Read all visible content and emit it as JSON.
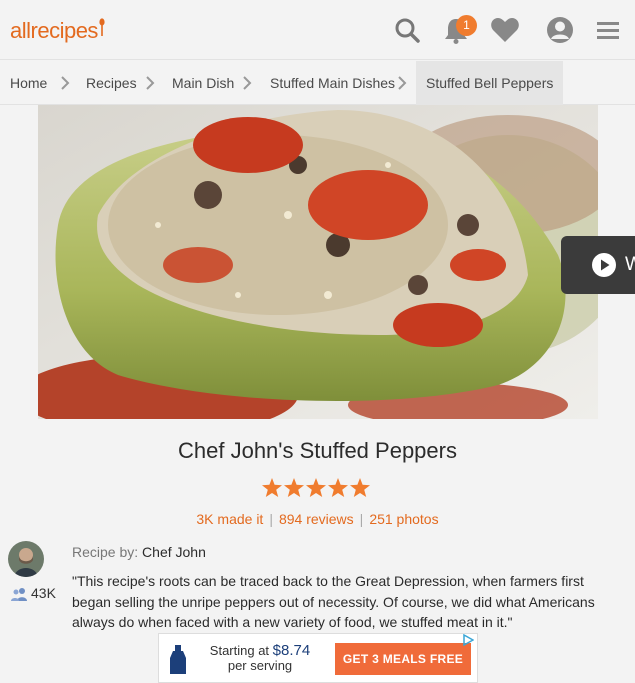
{
  "header": {
    "logo_text": "allrecipes",
    "notification_count": "1",
    "icons": [
      "search-icon",
      "bell-icon",
      "heart-icon",
      "profile-icon",
      "menu-icon"
    ],
    "brand_color": "#e36a1f"
  },
  "breadcrumb": {
    "items": [
      {
        "label": "Home"
      },
      {
        "label": "Recipes"
      },
      {
        "label": "Main Dish"
      },
      {
        "label": "Stuffed Main Dishes"
      },
      {
        "label": "Stuffed Bell Peppers"
      }
    ]
  },
  "recipe": {
    "title": "Chef John's Stuffed Peppers",
    "rating": 5,
    "made_it": "3K made it",
    "reviews": "894 reviews",
    "photos": "251 photos",
    "recipe_by_label": "Recipe by:",
    "author": "Chef John",
    "followers": "43K",
    "description": "\"This recipe's roots can be traced back to the Great Depression, when farmers first began selling the unripe peppers out of necessity. Of course, we did what Americans always do when faced with a new variety of food, we stuffed meat in it.\""
  },
  "video": {
    "label": "W"
  },
  "ad": {
    "line1": "Starting at",
    "price": "$8.74",
    "line2": "per serving",
    "cta": "GET 3 MEALS FREE",
    "cta_color": "#f06b3a"
  }
}
